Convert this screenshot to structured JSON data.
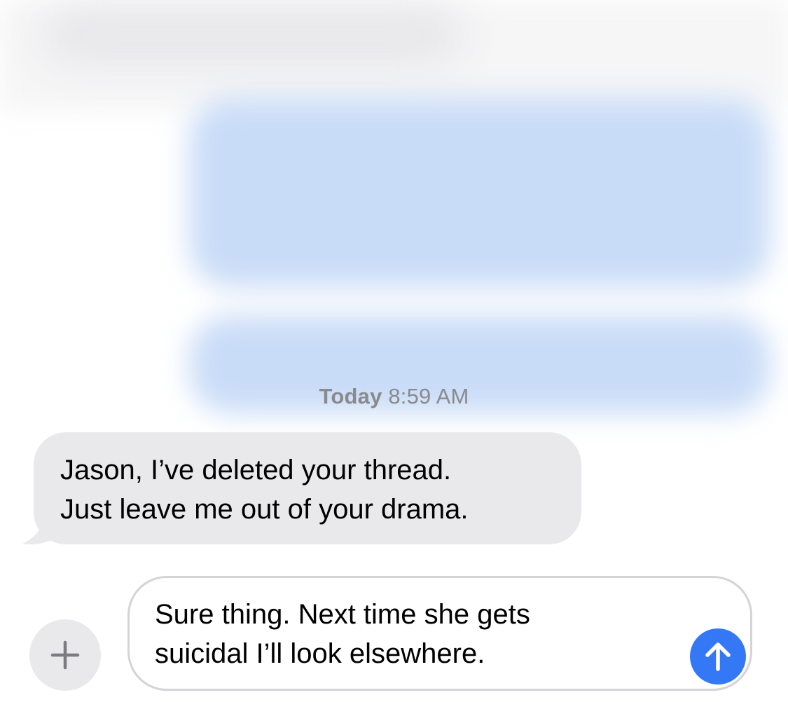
{
  "conversation": {
    "timestamp_day": "Today",
    "timestamp_time": "8:59 AM",
    "incoming_message": {
      "lines": [
        "Jason, I’ve deleted your thread.",
        "Just leave me out of your drama."
      ]
    }
  },
  "composer": {
    "plus_icon": "plus-icon",
    "text_lines": [
      "Sure thing. Next time she gets",
      "suicidal I’ll look elsewhere."
    ],
    "send_icon": "arrow-up-icon",
    "send_color": "#3478f6"
  },
  "colors": {
    "incoming_bubble": "#e9e9eb",
    "timestamp": "#8a8a8e",
    "redacted_outgoing": "#c9dcf7"
  }
}
